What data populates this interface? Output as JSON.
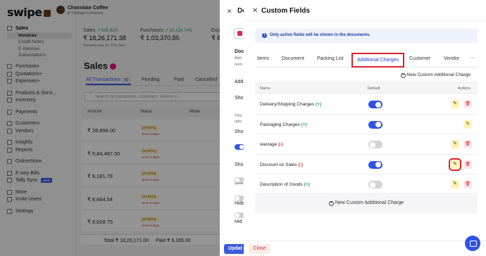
{
  "bg": {
    "logo": "swipe",
    "company_name": "Chocolate Coffee",
    "company_sub": "⇄ Change Company",
    "nav": [
      {
        "label": "Sales",
        "type": "main",
        "active": true
      },
      {
        "label": "Invoices",
        "type": "sub",
        "active": true
      },
      {
        "label": "Credit Notes",
        "type": "sub"
      },
      {
        "label": "E-Invoices",
        "type": "sub"
      },
      {
        "label": "Subscriptions",
        "type": "sub"
      },
      {
        "label": "Purchases",
        "type": "main"
      },
      {
        "label": "Quotations+",
        "type": "main"
      },
      {
        "label": "Expenses+",
        "type": "main"
      },
      {
        "label": "Products & Servi...",
        "type": "main"
      },
      {
        "label": "Inventory",
        "type": "main"
      },
      {
        "label": "Payments",
        "type": "main"
      },
      {
        "label": "Customers",
        "type": "main"
      },
      {
        "label": "Vendors",
        "type": "main"
      },
      {
        "label": "Insights",
        "type": "main"
      },
      {
        "label": "Reports",
        "type": "main"
      },
      {
        "label": "OnlineStore",
        "type": "main"
      },
      {
        "label": "E-way Bills",
        "type": "main"
      },
      {
        "label": "Tally Sync",
        "type": "main",
        "badge": "NEW"
      },
      {
        "label": "More",
        "type": "main"
      },
      {
        "label": "Invite Users",
        "type": "main"
      },
      {
        "label": "Settings",
        "type": "main"
      }
    ],
    "stats": {
      "sales_label": "Sales",
      "sales_pct": "↗ 695.82%",
      "sales_value": "₹ 18,26,171.38",
      "purchases_label": "Purchases",
      "purchases_pct": "↗ 10,134.74%",
      "purchases_value": "₹ 1,03,370.85",
      "exp_label": "Exp",
      "exp_value": "₹ 8",
      "note": "Showing data for This Year"
    },
    "page_title": "Sales",
    "tabs": [
      {
        "label": "All Transactions",
        "count": "50",
        "active": true
      },
      {
        "label": "Pending"
      },
      {
        "label": "Paid"
      },
      {
        "label": "Cancelled"
      }
    ],
    "search_placeholder": "Search by transaction, customers, invoice #...",
    "columns": [
      "Amount",
      "Status",
      "Mode"
    ],
    "rows": [
      {
        "amount": "₹ 28,896.00",
        "status": "pending",
        "since": "since 1 days"
      },
      {
        "amount": "₹ 9,84,487.50",
        "status": "pending",
        "since": "since 5 days"
      },
      {
        "amount": "₹ 9,181.78",
        "status": "pending",
        "since": "since 8 days"
      },
      {
        "amount": "₹ 8,664.54",
        "status": "pending",
        "since": "since 6 days"
      },
      {
        "amount": "₹ 9,028.75",
        "status": "pending",
        "since": "since 6 days"
      }
    ],
    "footer_total": "Total ₹ 18,26,171.00",
    "footer_paid": "Paid ₹ 6,165.00"
  },
  "drawer1": {
    "title": "De",
    "button_label": "In",
    "lines": [
      {
        "text": "Doc",
        "style": "bold"
      },
      {
        "text": "Add",
        "style": "muted"
      },
      {
        "text": "num",
        "style": "muted"
      },
      {
        "text": "Additi",
        "style": "normal"
      },
      {
        "text": "Sho",
        "style": "normal"
      },
      {
        "text": "This",
        "style": "muted"
      },
      {
        "text": "uplo",
        "style": "muted"
      },
      {
        "text": "Sho",
        "style": "normal"
      },
      {
        "text": "Sho",
        "style": "normal"
      },
      {
        "text": "Sho",
        "style": "normal"
      },
      {
        "text": "Hide",
        "style": "normal"
      },
      {
        "text": "Hid",
        "style": "normal"
      }
    ],
    "update_label": "Updat"
  },
  "custom_fields": {
    "title": "Custom Fields",
    "info": "Only active fields will be shown in the documents.",
    "tabs": [
      {
        "label": "Items"
      },
      {
        "label": "Document"
      },
      {
        "label": "Packing List"
      },
      {
        "label": "Additional Charges",
        "active": true
      },
      {
        "label": "Customer"
      },
      {
        "label": "Vendor"
      }
    ],
    "more_label": "···",
    "add_link": "New Custom Additional Charge",
    "columns": {
      "name": "Name",
      "default": "Default",
      "actions": "Actions"
    },
    "rows": [
      {
        "name": "Delivery/Shipping Charges",
        "sign": "(+)",
        "default_on": true,
        "deletable": true
      },
      {
        "name": "Packaging Charges",
        "sign": "(+)",
        "default_on": true,
        "deletable": false
      },
      {
        "name": "wastage",
        "sign": "(-)",
        "default_on": false,
        "deletable": true
      },
      {
        "name": "Discount on Sales",
        "sign": "(-)",
        "default_on": true,
        "deletable": true,
        "highlight_edit": true
      },
      {
        "name": "Description of Goods",
        "sign": "(+)",
        "default_on": false,
        "deletable": true
      }
    ],
    "add_box": "New Custom Additional Charge",
    "close_label": "Close"
  },
  "colors": {
    "accent": "#2f53e6",
    "highlight": "#d8232a",
    "edit_bg": "#fff3b8",
    "delete_bg": "#ffe6ea"
  }
}
